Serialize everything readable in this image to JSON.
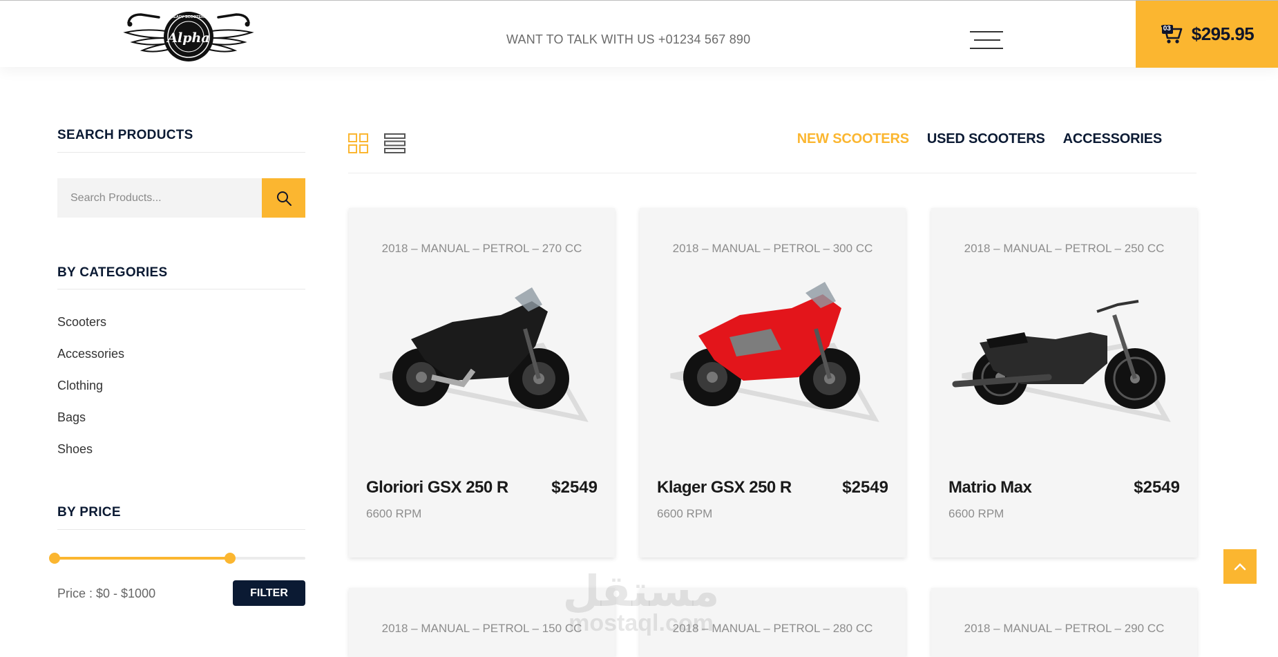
{
  "header": {
    "logo_text": "Alpha",
    "logo_ring_text": "READY SCOOTERS",
    "contact_text": "WANT TO TALK WITH US +01234 567 890",
    "cart_count": "03",
    "cart_total": "$295.95",
    "accent_color": "#fbb630",
    "dark_color": "#0b1a33"
  },
  "sidebar": {
    "search_title": "SEARCH PRODUCTS",
    "search_placeholder": "Search Products...",
    "categories_title": "BY CATEGORIES",
    "categories": [
      "Scooters",
      "Accessories",
      "Clothing",
      "Bags",
      "Shoes"
    ],
    "price_title": "BY PRICE",
    "price_range": {
      "min": 0,
      "max": 1000,
      "low_fraction": 0.0,
      "high_fraction": 0.7
    },
    "price_label": "Price : $0 - $1000",
    "filter_label": "FILTER"
  },
  "toolbar": {
    "tabs": [
      "NEW SCOOTERS",
      "USED SCOOTERS",
      "ACCESSORIES"
    ],
    "active_tab": "NEW SCOOTERS",
    "views": [
      "grid-view-icon",
      "list-view-icon"
    ]
  },
  "products": [
    {
      "specs": "2018 – MANUAL – PETROL – 270 CC",
      "name": "Gloriori GSX 250 R",
      "price": "$2549",
      "rpm": "6600 RPM",
      "color": "#1b1b1b"
    },
    {
      "specs": "2018 – MANUAL – PETROL – 300 CC",
      "name": "Klager GSX 250 R",
      "price": "$2549",
      "rpm": "6600 RPM",
      "color": "#e3151b"
    },
    {
      "specs": "2018 – MANUAL – PETROL – 250 CC",
      "name": "Matrio Max",
      "price": "$2549",
      "rpm": "6600 RPM",
      "color": "#2a2a2a"
    },
    {
      "specs": "2018 – MANUAL – PETROL – 150 CC"
    },
    {
      "specs": "2018 – MANUAL – PETROL – 280 CC"
    },
    {
      "specs": "2018 – MANUAL – PETROL – 290 CC"
    }
  ],
  "watermark": {
    "arabic": "مستقل",
    "latin": "mostaql.com"
  }
}
